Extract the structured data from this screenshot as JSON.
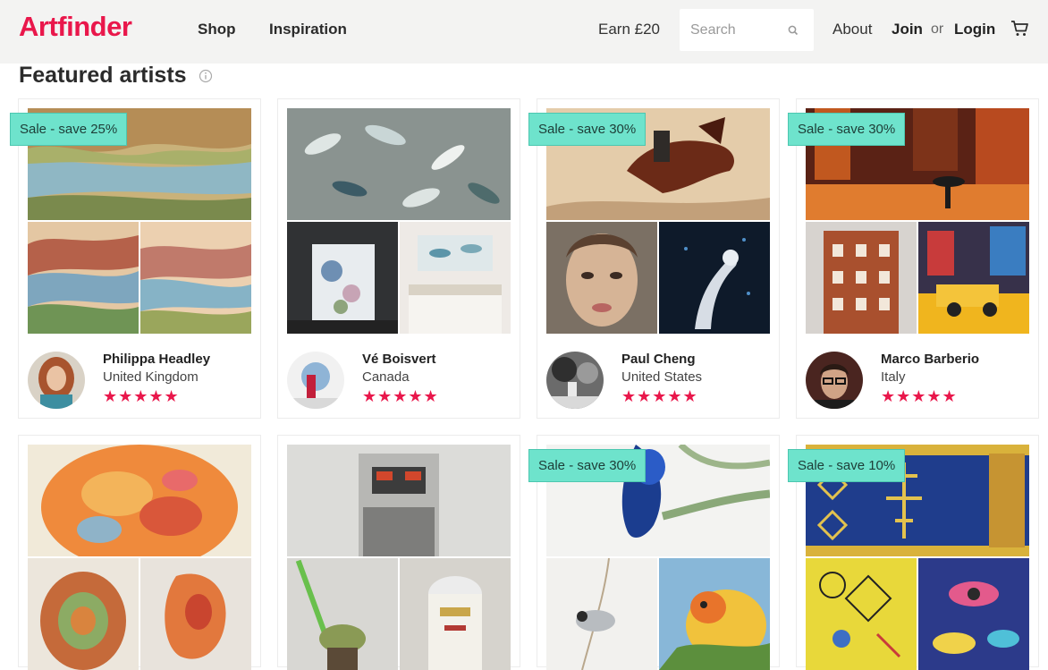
{
  "header": {
    "logo": "Artfinder",
    "nav": {
      "shop": "Shop",
      "inspiration": "Inspiration"
    },
    "earn": "Earn £20",
    "search_placeholder": "Search",
    "about": "About",
    "join": "Join",
    "or": "or",
    "login": "Login"
  },
  "section": {
    "title": "Featured artists"
  },
  "colors": {
    "brand": "#e9174b",
    "sale_badge": "#6ee3cc",
    "header_bg": "#f3f3f2"
  },
  "cards": [
    {
      "name": "Philippa Headley",
      "country": "United Kingdom",
      "rating": 5,
      "stars": "★★★★★",
      "sale": "Sale - save 25%"
    },
    {
      "name": "Vé Boisvert",
      "country": "Canada",
      "rating": 5,
      "stars": "★★★★★",
      "sale": ""
    },
    {
      "name": "Paul Cheng",
      "country": "United States",
      "rating": 5,
      "stars": "★★★★★",
      "sale": "Sale - save 30%"
    },
    {
      "name": "Marco Barberio",
      "country": "Italy",
      "rating": 5,
      "stars": "★★★★★",
      "sale": "Sale - save 30%"
    },
    {
      "name": "",
      "country": "",
      "sale": ""
    },
    {
      "name": "",
      "country": "",
      "sale": ""
    },
    {
      "name": "",
      "country": "",
      "sale": "Sale - save 30%"
    },
    {
      "name": "",
      "country": "",
      "sale": "Sale - save 10%"
    }
  ],
  "icons": {
    "search": "search-icon",
    "cart": "cart-icon",
    "info": "info-icon",
    "star": "star-icon"
  }
}
